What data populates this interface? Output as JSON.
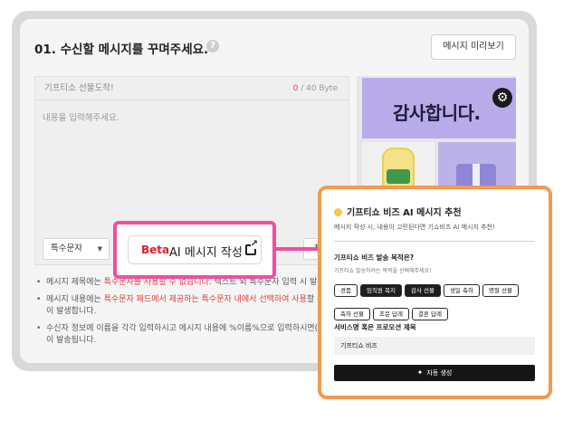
{
  "section": {
    "title": "01. 수신할 메시지를 꾸며주세요.",
    "preview_button": "메시지 미리보기"
  },
  "editor": {
    "subject_value": "기프티쇼 선물도착!",
    "byte_current": "0",
    "byte_max": "/ 40 Byte",
    "body_placeholder": "내용을 입력해주세요.",
    "byte_current_body": "0",
    "special_char_select": "특수문자",
    "side_button": "적용"
  },
  "phone_preview": {
    "banner_text": "감사합니다."
  },
  "notes": [
    {
      "pre": "메시지 제목에는 ",
      "red": "특수문자를 사용할 수 없습니다.",
      "post": " 텍스트 외 특수문자 입력 시 발송이"
    },
    {
      "pre": "메시지 내용에는 ",
      "red": "특수문자 패드에서 제공하는 특수문자 내에서 선택하여 사용",
      "post": "할 수 있"
    },
    {
      "pre": "이 발생합니다.",
      "red": "",
      "post": ""
    },
    {
      "pre": "수신자 정보에 이름을 각각 입력하시고 메시지 내용에 %이름%으로 입력하시면(예시",
      "red": "",
      "post": ""
    },
    {
      "pre": "이 발송됩니다.",
      "red": "",
      "post": ""
    }
  ],
  "beta_button": {
    "tag": "Beta",
    "label": "AI 메시지 작성"
  },
  "ai_popup": {
    "title": "기프티쇼 비즈 AI 메시지 추천",
    "description": "메시지 작성 시, 내용이 고민된다면 기쇼비즈 AI 메시지 추천!",
    "question1": "기프티쇼 비즈 발송 목적은?",
    "question1_hint": "기프티쇼 발송하려는 목적을 선택해주세요!",
    "purposes": [
      {
        "label": "경품",
        "selected": false
      },
      {
        "label": "임직원 복지",
        "selected": true
      },
      {
        "label": "감사 선물",
        "selected": true
      },
      {
        "label": "생일 축하",
        "selected": false
      },
      {
        "label": "명절 선물",
        "selected": false
      },
      {
        "label": "축하 선물",
        "selected": false
      },
      {
        "label": "조문 답례",
        "selected": false
      },
      {
        "label": "결혼 답례",
        "selected": false
      }
    ],
    "question2": "서비스명 혹은 프로모션 제목",
    "service_value": "기프티쇼 비즈",
    "generate_button": "자동 생성"
  },
  "colors": {
    "callout_pink": "#f04ea0",
    "popup_orange": "#f39a50",
    "beta_red": "#e21b2c",
    "banner_purple": "#b9abea"
  }
}
